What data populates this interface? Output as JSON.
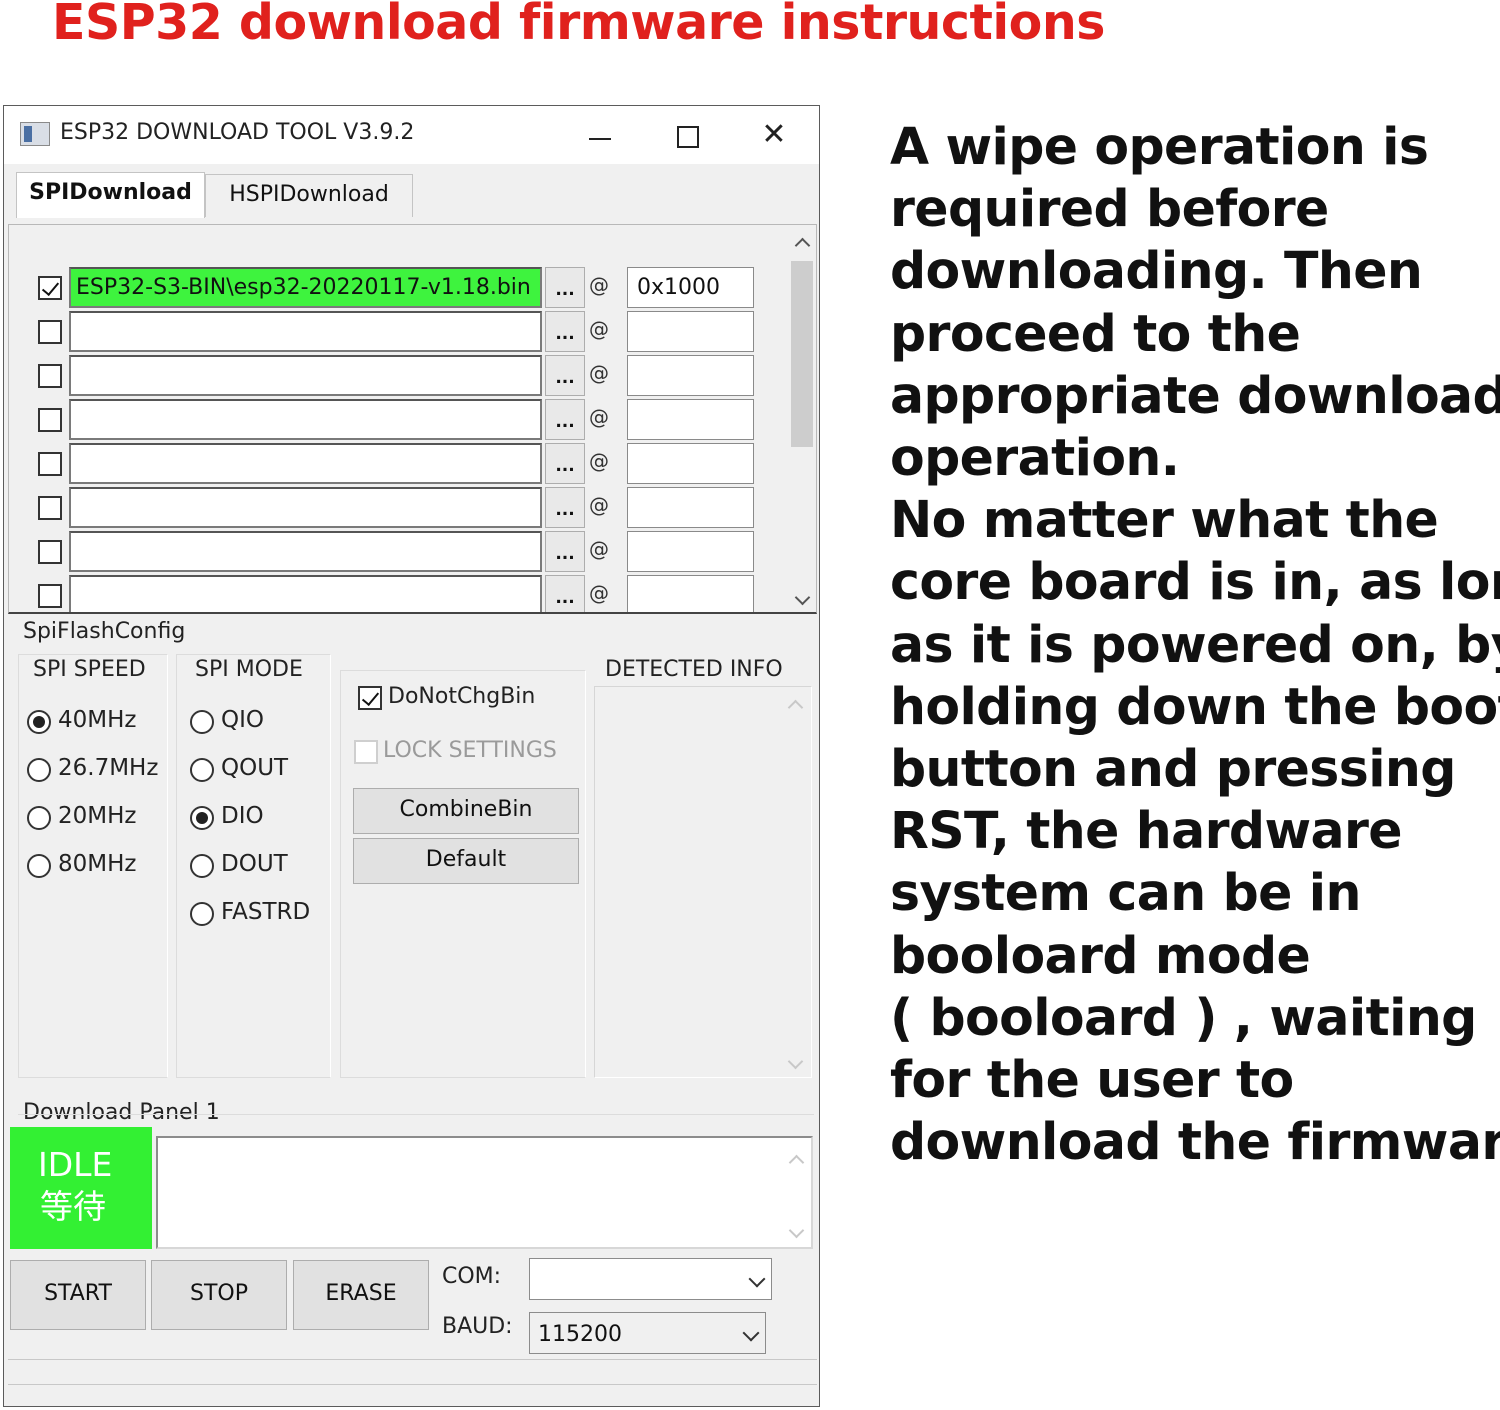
{
  "heading": "ESP32 download firmware instructions",
  "instructions": "A wipe operation is\nrequired before\ndownloading. Then\nproceed to the\nappropriate download\noperation.\nNo matter what the\ncore board is in, as long\nas it is powered on, by\nholding down the boot\nbutton and pressing\nRST, the hardware\nsystem can be in\nbooloard mode\n( booloard ) , waiting\nfor the user to\ndownload the firmware.",
  "window": {
    "title": "ESP32 DOWNLOAD TOOL V3.9.2",
    "minimize": "",
    "maximize": "",
    "close": "✕"
  },
  "tabs": [
    {
      "label": "SPIDownload",
      "active": true
    },
    {
      "label": "HSPIDownload",
      "active": false
    }
  ],
  "files": [
    {
      "checked": true,
      "path": "ESP32-S3-BIN\\esp32-20220117-v1.18.bin",
      "browse": "...",
      "at": "@",
      "address": "0x1000"
    },
    {
      "checked": false,
      "path": "",
      "browse": "...",
      "at": "@",
      "address": ""
    },
    {
      "checked": false,
      "path": "",
      "browse": "...",
      "at": "@",
      "address": ""
    },
    {
      "checked": false,
      "path": "",
      "browse": "...",
      "at": "@",
      "address": ""
    },
    {
      "checked": false,
      "path": "",
      "browse": "...",
      "at": "@",
      "address": ""
    },
    {
      "checked": false,
      "path": "",
      "browse": "...",
      "at": "@",
      "address": ""
    },
    {
      "checked": false,
      "path": "",
      "browse": "...",
      "at": "@",
      "address": ""
    },
    {
      "checked": false,
      "path": "",
      "browse": "...",
      "at": "@",
      "address": ""
    }
  ],
  "config": {
    "section_label": "SpiFlashConfig",
    "spi_speed": {
      "label": "SPI SPEED",
      "options": [
        "40MHz",
        "26.7MHz",
        "20MHz",
        "80MHz"
      ],
      "selected": "40MHz"
    },
    "spi_mode": {
      "label": "SPI MODE",
      "options": [
        "QIO",
        "QOUT",
        "DIO",
        "DOUT",
        "FASTRD"
      ],
      "selected": "DIO"
    },
    "do_not_chg_bin": {
      "label": "DoNotChgBin",
      "checked": true
    },
    "lock_settings": {
      "label": "LOCK SETTINGS",
      "checked": false,
      "enabled": false
    },
    "combine_bin_label": "CombineBin",
    "default_label": "Default",
    "detected_info_label": "DETECTED INFO"
  },
  "download_panel": {
    "label": "Download Panel 1",
    "status_en": "IDLE",
    "status_cn": "等待",
    "status_color": "#33f033",
    "start_label": "START",
    "stop_label": "STOP",
    "erase_label": "ERASE",
    "com_label": "COM:",
    "com_value": "",
    "baud_label": "BAUD:",
    "baud_value": "115200"
  },
  "colors": {
    "heading": "#e0211d",
    "file_filled": "#3ef33e"
  }
}
